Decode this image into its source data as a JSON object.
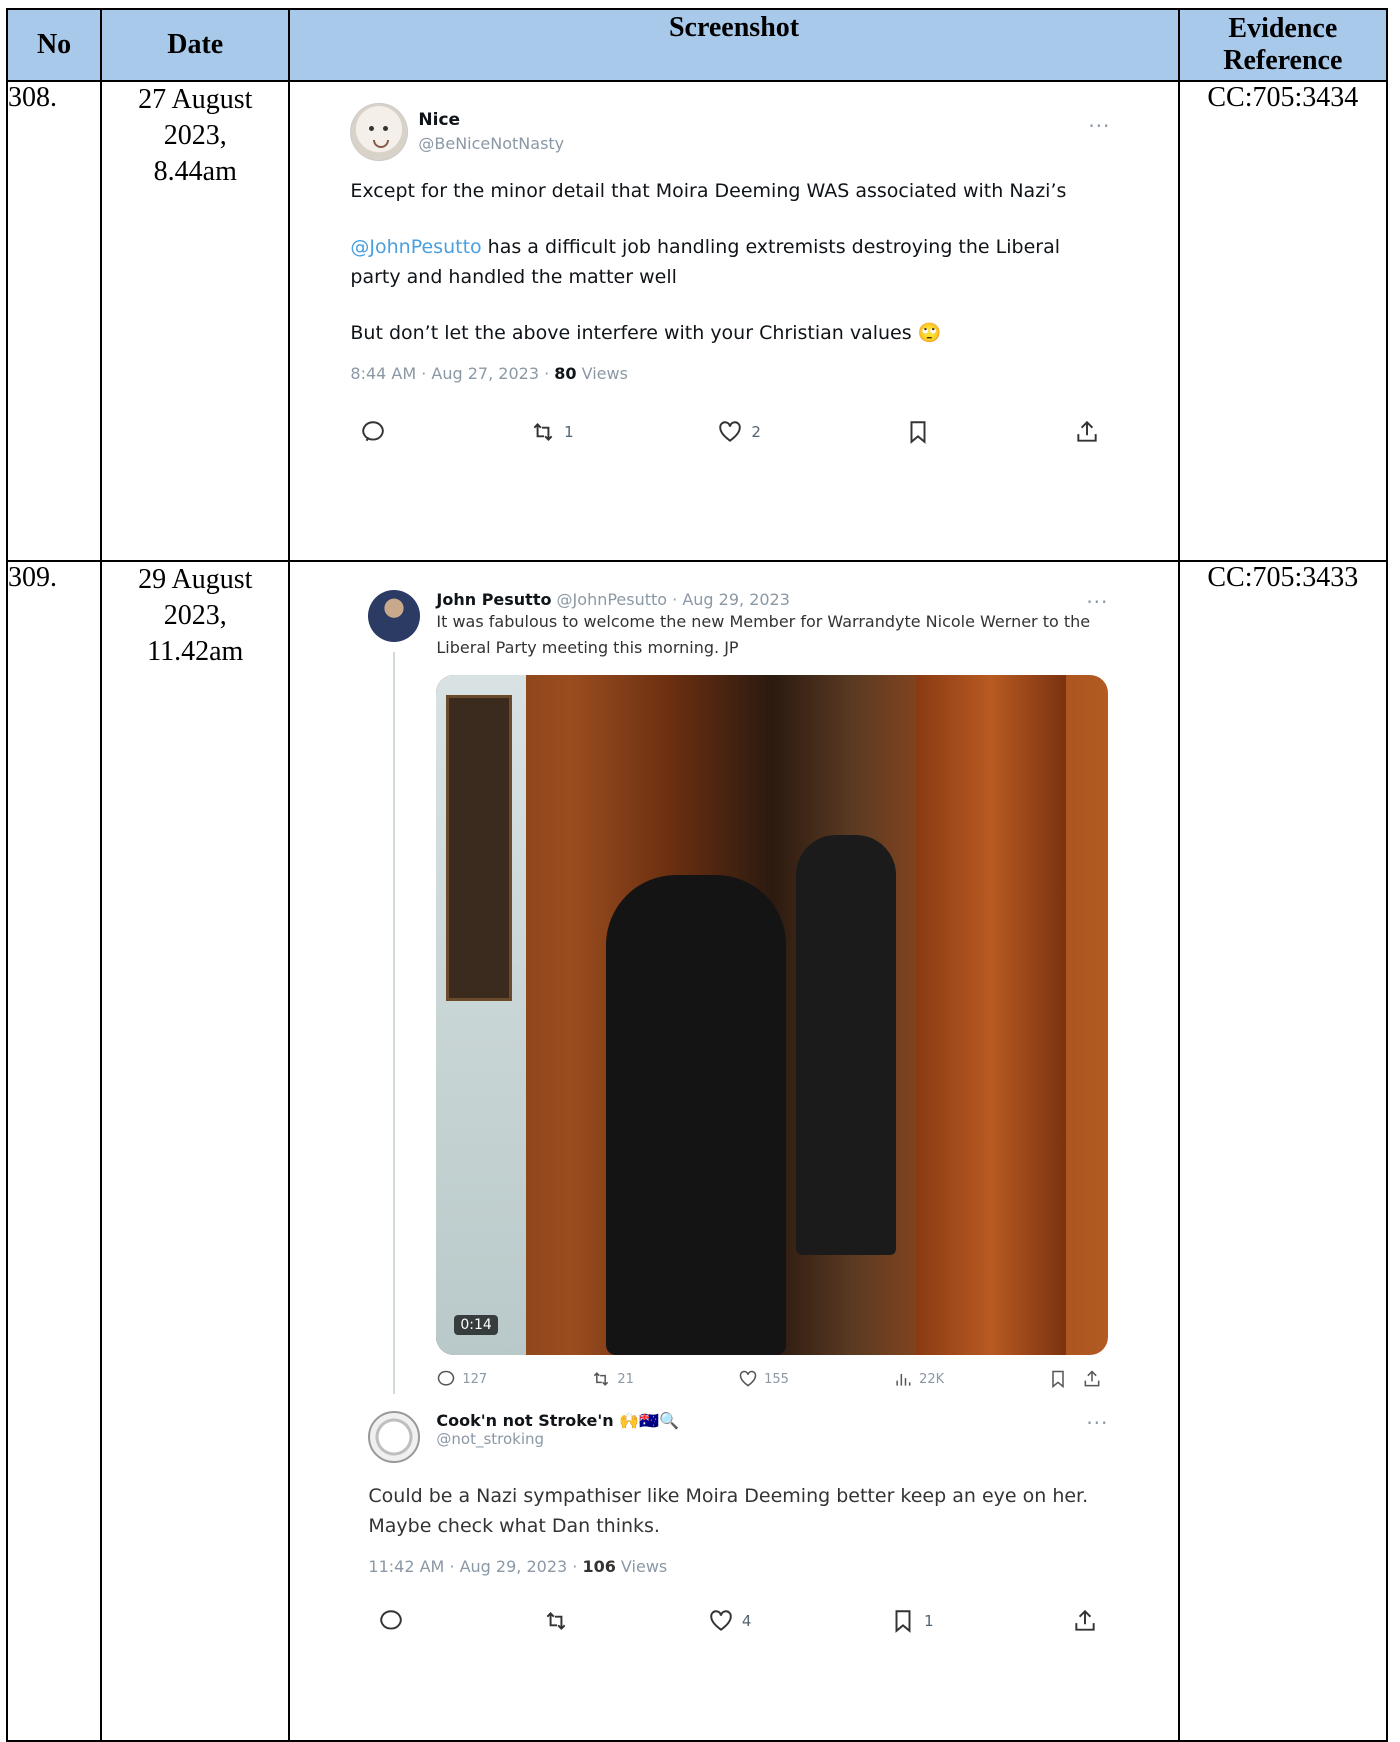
{
  "table": {
    "headers": {
      "no": "No",
      "date": "Date",
      "screenshot": "Screenshot",
      "reference": "Evidence Reference"
    },
    "rows": [
      {
        "no": "308.",
        "date": "27 August 2023, 8.44am",
        "reference": "CC:705:3434",
        "tweet": {
          "name": "Nice",
          "handle": "@BeNiceNotNasty",
          "para1": "Except for the minor detail that Moira Deeming WAS associated with Nazi’s",
          "mention": "@JohnPesutto",
          "para2_rest": " has a difficult job handling extremists destroying the Liberal party and handled the matter well",
          "para3": "But don’t let the above interfere with your Christian values 🙄",
          "time": "8:44 AM · Aug 27, 2023 · ",
          "views_count": "80",
          "views_label": " Views",
          "retweets": "1",
          "likes": "2"
        }
      },
      {
        "no": "309.",
        "date": "29 August 2023, 11.42am",
        "reference": "CC:705:3433",
        "quoted": {
          "name": "John Pesutto",
          "handle_time": " @JohnPesutto · Aug 29, 2023",
          "text": "It was fabulous to welcome the new Member for Warrandyte Nicole Werner to the Liberal Party meeting this morning. JP",
          "video_time": "0:14",
          "replies": "127",
          "retweets": "21",
          "likes": "155",
          "views": "22K"
        },
        "reply": {
          "name": "Cook'n not Stroke'n 🙌🇦🇺🔍",
          "handle": "@not_stroking",
          "text": "Could be a Nazi sympathiser like Moira Deeming better keep an eye on her. Maybe check what Dan thinks.",
          "time": "11:42 AM · Aug 29, 2023 · ",
          "views_count": "106",
          "views_label": " Views",
          "likes": "4",
          "bookmarks": "1"
        }
      }
    ]
  },
  "icons": [
    "reply-icon",
    "retweet-icon",
    "like-icon",
    "bookmark-icon",
    "share-icon",
    "views-icon"
  ]
}
